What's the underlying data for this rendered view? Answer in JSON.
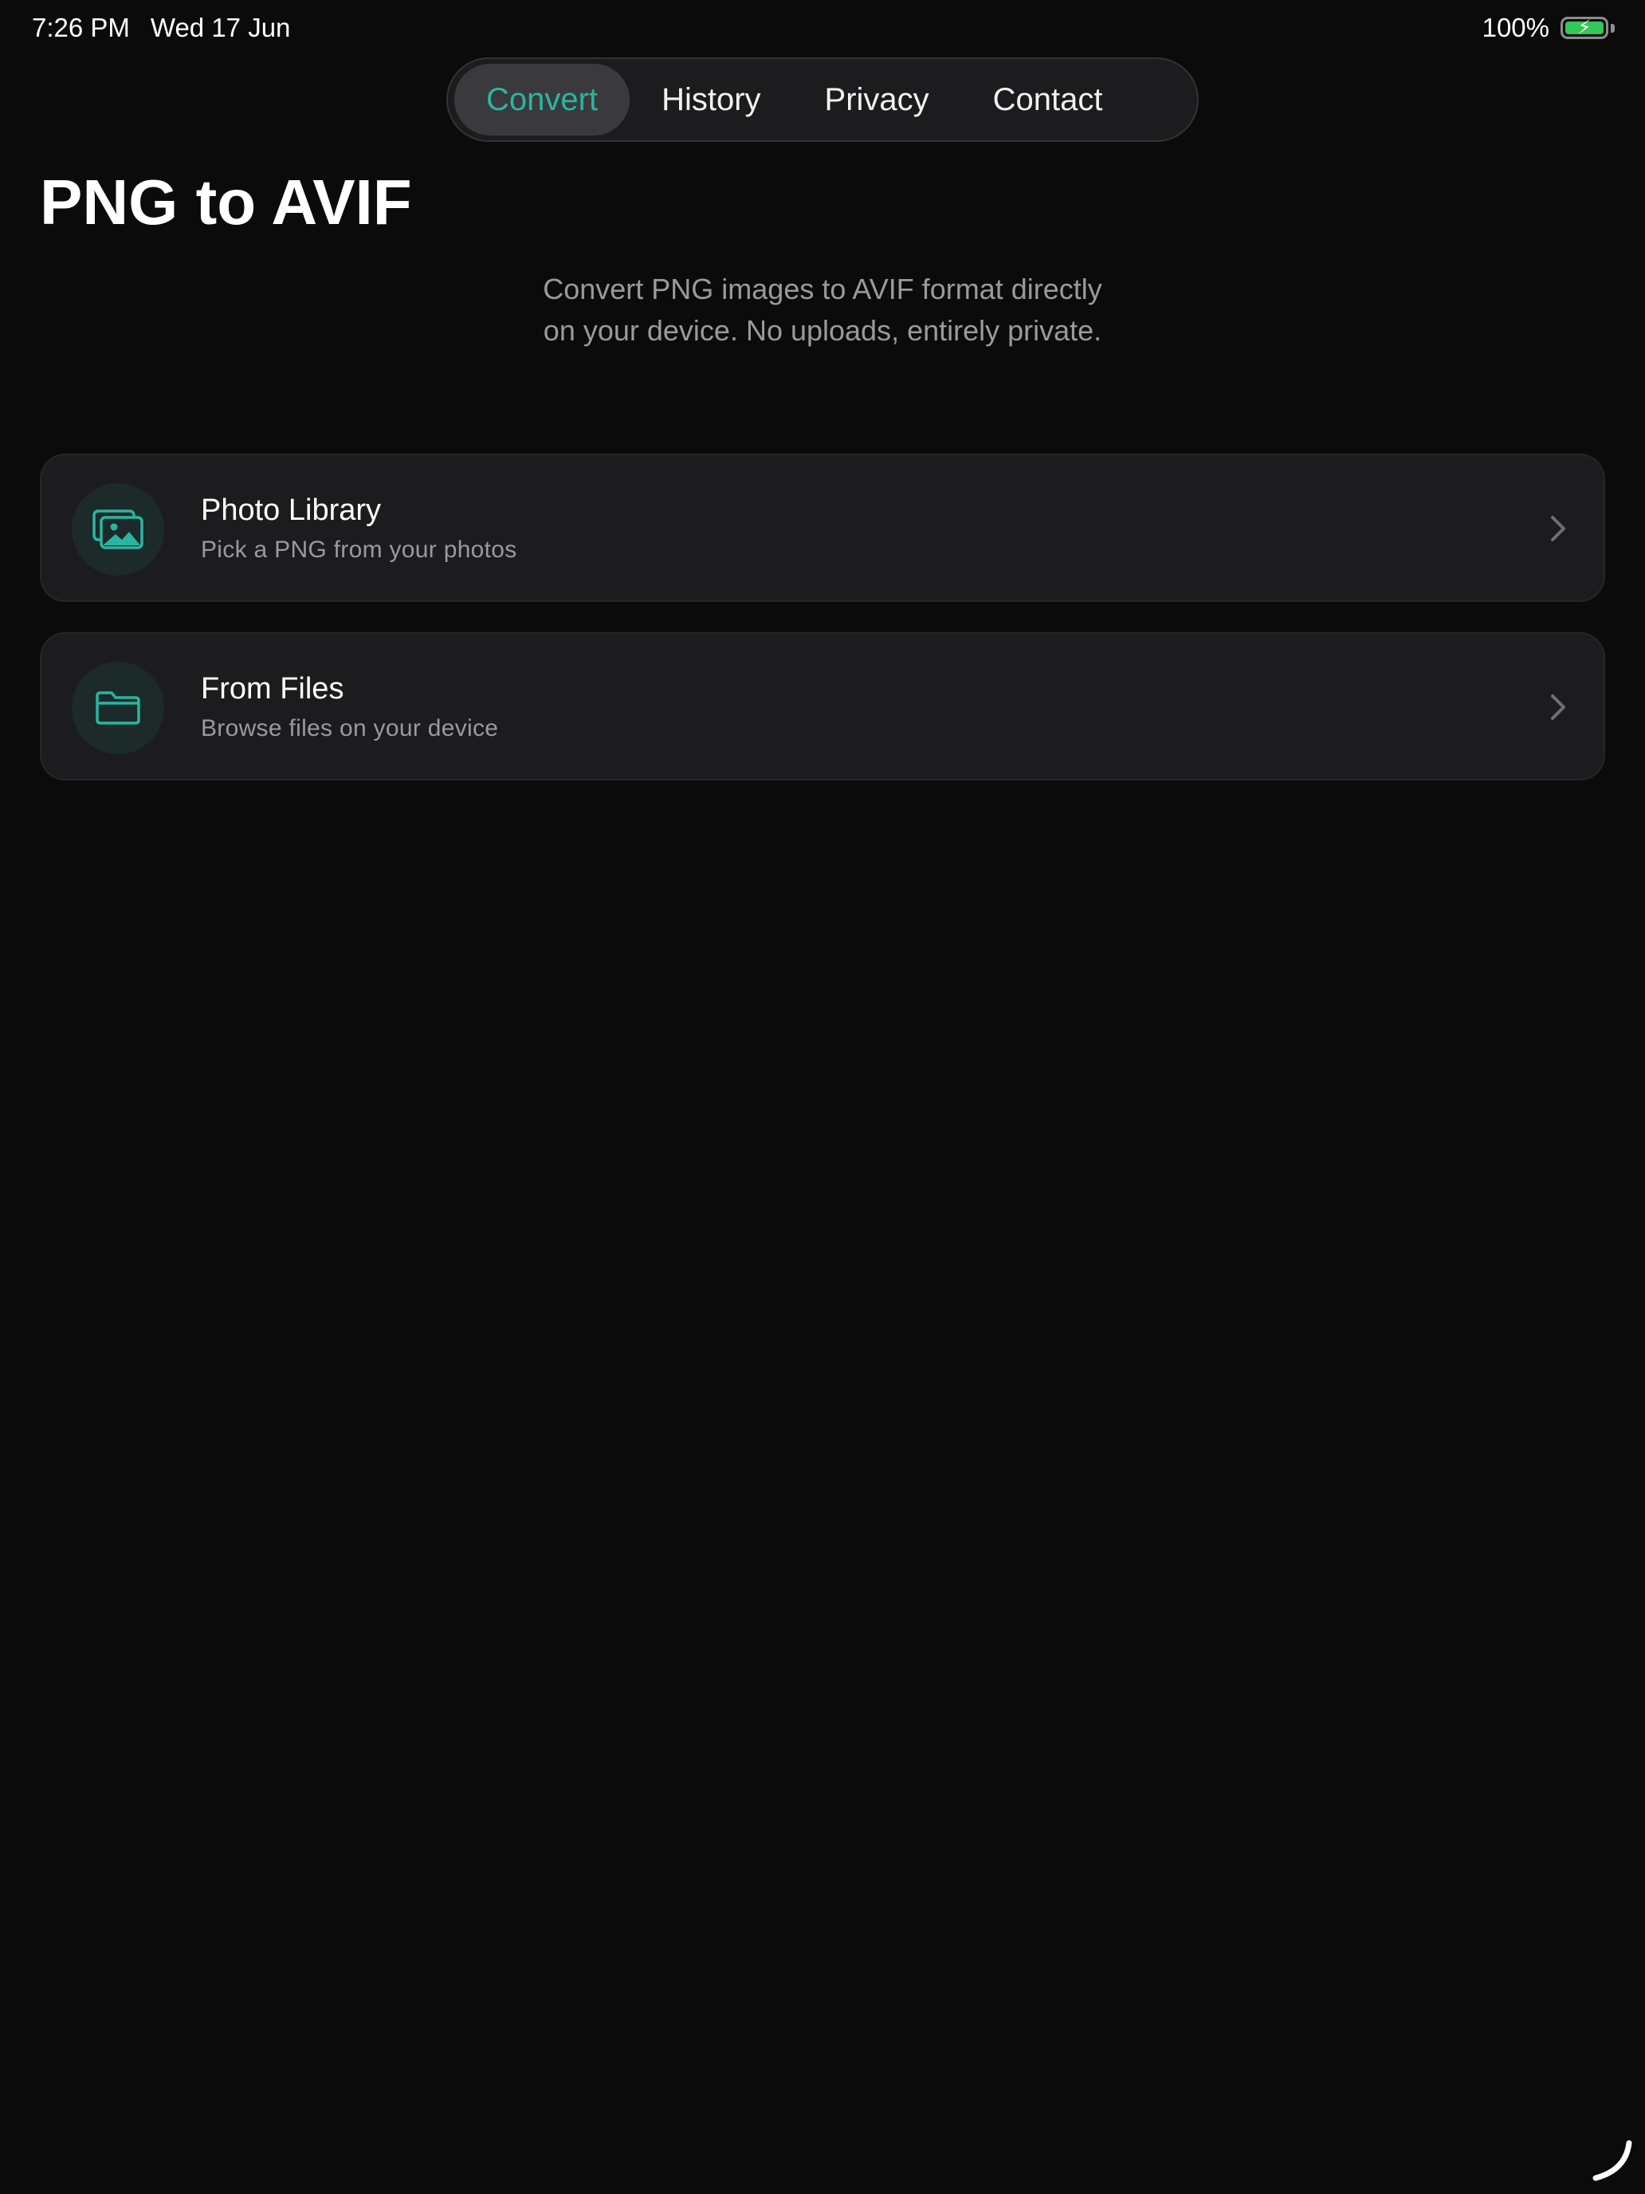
{
  "status_bar": {
    "time": "7:26 PM",
    "date": "Wed 17 Jun",
    "battery_percent": "100%",
    "battery_icon": "battery-charging-icon",
    "battery_color": "#34c759"
  },
  "tabs": [
    {
      "label": "Convert",
      "active": true
    },
    {
      "label": "History",
      "active": false
    },
    {
      "label": "Privacy",
      "active": false
    },
    {
      "label": "Contact",
      "active": false
    }
  ],
  "accent_color": "#2bb5a0",
  "main": {
    "title": "PNG to AVIF",
    "subtitle_line1": "Convert PNG images to AVIF format directly",
    "subtitle_line2": "on your device. No uploads, entirely private."
  },
  "options": [
    {
      "title": "Photo Library",
      "description": "Pick a PNG from your photos",
      "icon": "photo-library-icon"
    },
    {
      "title": "From Files",
      "description": "Browse files on your device",
      "icon": "folder-icon"
    }
  ]
}
